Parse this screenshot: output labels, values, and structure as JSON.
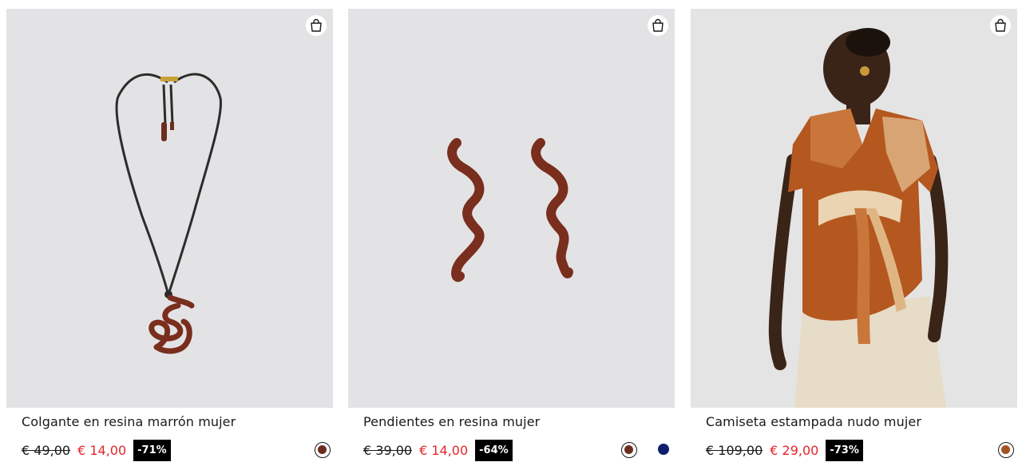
{
  "products": [
    {
      "name": "Colgante en resina marrón mujer",
      "old_price": "€ 49,00",
      "new_price": "€ 14,00",
      "discount": "-71%",
      "colors": [
        "#6b2e1e"
      ]
    },
    {
      "name": "Pendientes en resina mujer",
      "old_price": "€ 39,00",
      "new_price": "€ 14,00",
      "discount": "-64%",
      "colors": [
        "#6b2e1e",
        "#0e1f6e"
      ]
    },
    {
      "name": "Camiseta estampada nudo mujer",
      "old_price": "€ 109,00",
      "new_price": "€ 29,00",
      "discount": "-73%",
      "colors": [
        "#a4521f"
      ]
    }
  ],
  "icons": {
    "add_to_bag": "shopping-bag-icon"
  },
  "theme": {
    "sale_red": "#e5252a",
    "discount_bg": "#000000",
    "image_bg": "#e3e3e5"
  }
}
